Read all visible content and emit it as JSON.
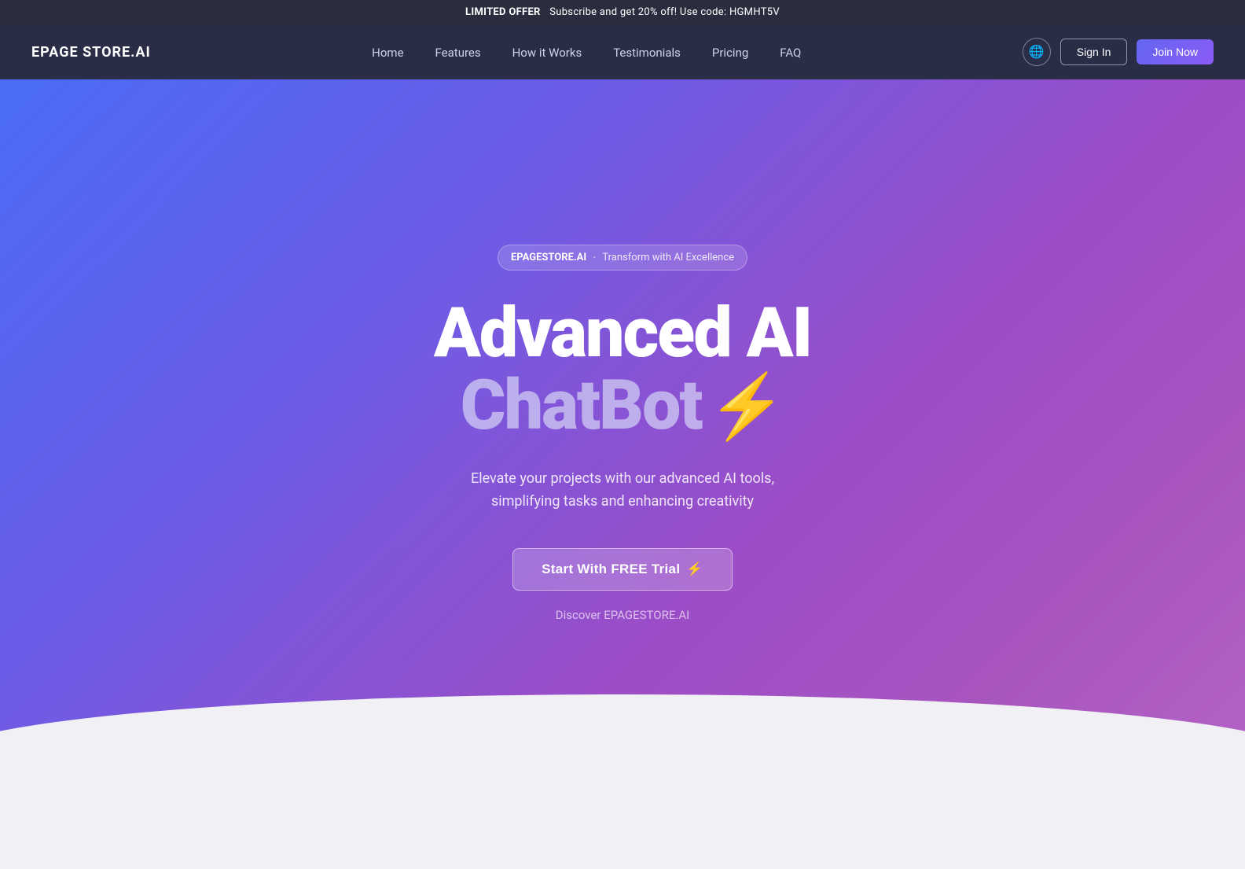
{
  "announcement": {
    "label": "LIMITED OFFER",
    "text": "Subscribe and get 20% off! Use code: HGMHT5V"
  },
  "navbar": {
    "logo": "EPAGE STORE.AI",
    "links": [
      {
        "label": "Home",
        "href": "#"
      },
      {
        "label": "Features",
        "href": "#"
      },
      {
        "label": "How it Works",
        "href": "#"
      },
      {
        "label": "Testimonials",
        "href": "#"
      },
      {
        "label": "Pricing",
        "href": "#"
      },
      {
        "label": "FAQ",
        "href": "#"
      }
    ],
    "sign_in_label": "Sign In",
    "join_now_label": "Join Now"
  },
  "hero": {
    "badge_brand": "EPAGESTORE.AI",
    "badge_dot": "·",
    "badge_tagline": "Transform with AI Excellence",
    "title_line1": "Advanced AI",
    "title_line2": "ChatBot",
    "lightning_icon": "⚡",
    "description": "Elevate your projects with our advanced AI tools, simplifying tasks and enhancing creativity",
    "cta_label": "Start With FREE Trial",
    "cta_icon": "⚡",
    "discover_label": "Discover EPAGESTORE.AI"
  }
}
